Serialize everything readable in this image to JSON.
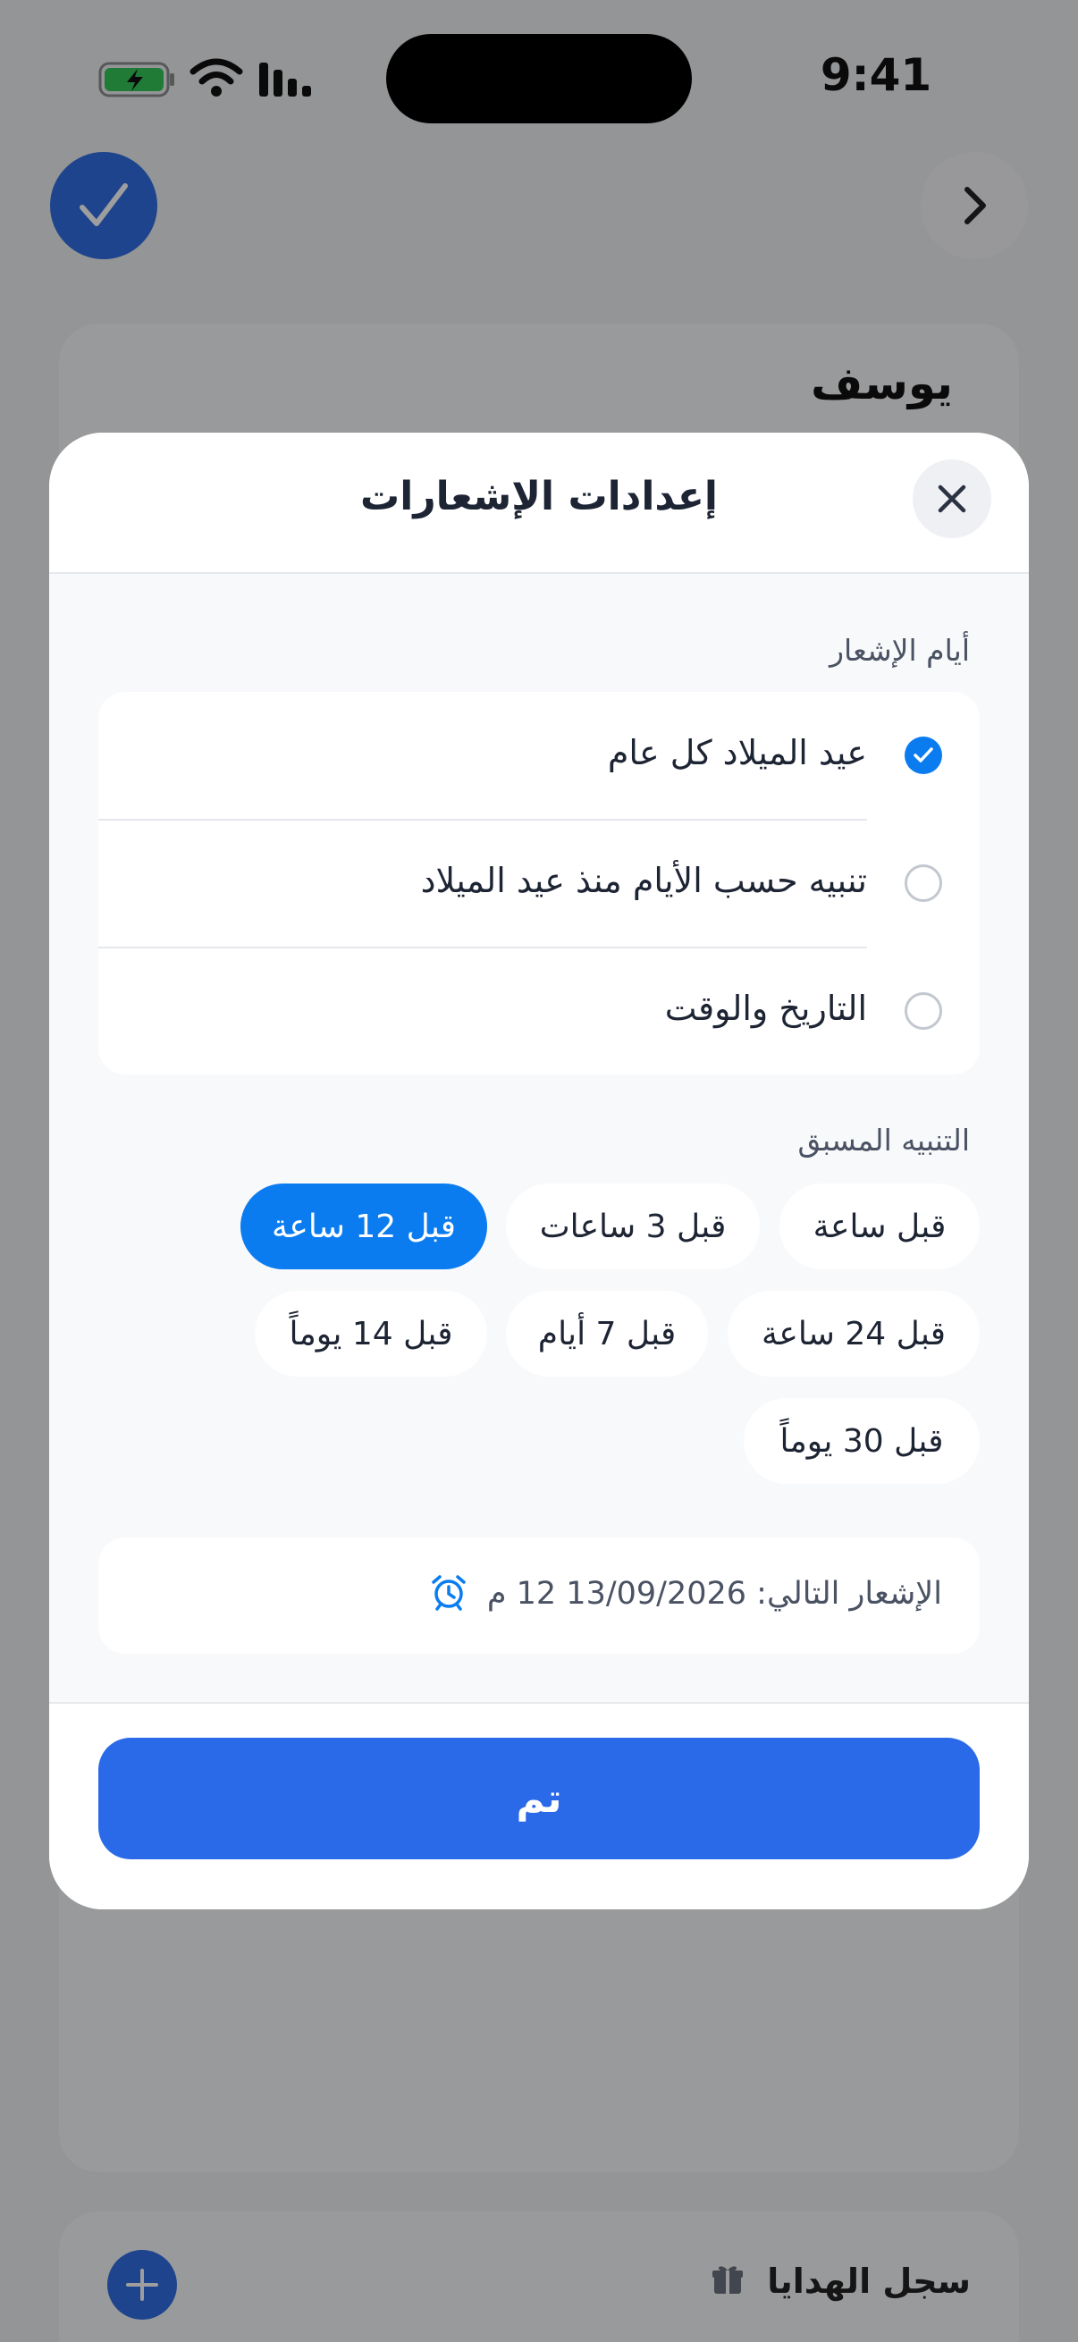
{
  "status_bar": {
    "time": "9:41"
  },
  "background": {
    "contact_name": "يوسف",
    "gift_log_label": "سجل الهدايا"
  },
  "modal": {
    "title": "إعدادات الإشعارات",
    "notification_days": {
      "label": "أيام الإشعار",
      "options": [
        {
          "label": "عيد الميلاد كل عام",
          "selected": true
        },
        {
          "label": "تنبيه حسب الأيام منذ عيد الميلاد",
          "selected": false
        },
        {
          "label": "التاريخ والوقت",
          "selected": false
        }
      ]
    },
    "advance_alert": {
      "label": "التنبيه المسبق",
      "chips": [
        {
          "label": "قبل ساعة",
          "selected": false
        },
        {
          "label": "قبل 3 ساعات",
          "selected": false
        },
        {
          "label": "قبل 12 ساعة",
          "selected": true
        },
        {
          "label": "قبل 24 ساعة",
          "selected": false
        },
        {
          "label": "قبل 7 أيام",
          "selected": false
        },
        {
          "label": "قبل 14 يوماً",
          "selected": false
        },
        {
          "label": "قبل 30 يوماً",
          "selected": false
        }
      ]
    },
    "next_notification": "الإشعار التالي: 13/09/2026 12 م",
    "done_label": "تم"
  },
  "colors": {
    "accent": "#0a7cf0",
    "primary_button": "#2a6ae9",
    "battery_fill": "#34c759"
  },
  "icons": {
    "check": "check-icon",
    "chevron": "chevron-right-icon",
    "close": "close-icon",
    "alarm": "alarm-clock-icon",
    "gift": "gift-icon",
    "plus": "plus-icon"
  }
}
